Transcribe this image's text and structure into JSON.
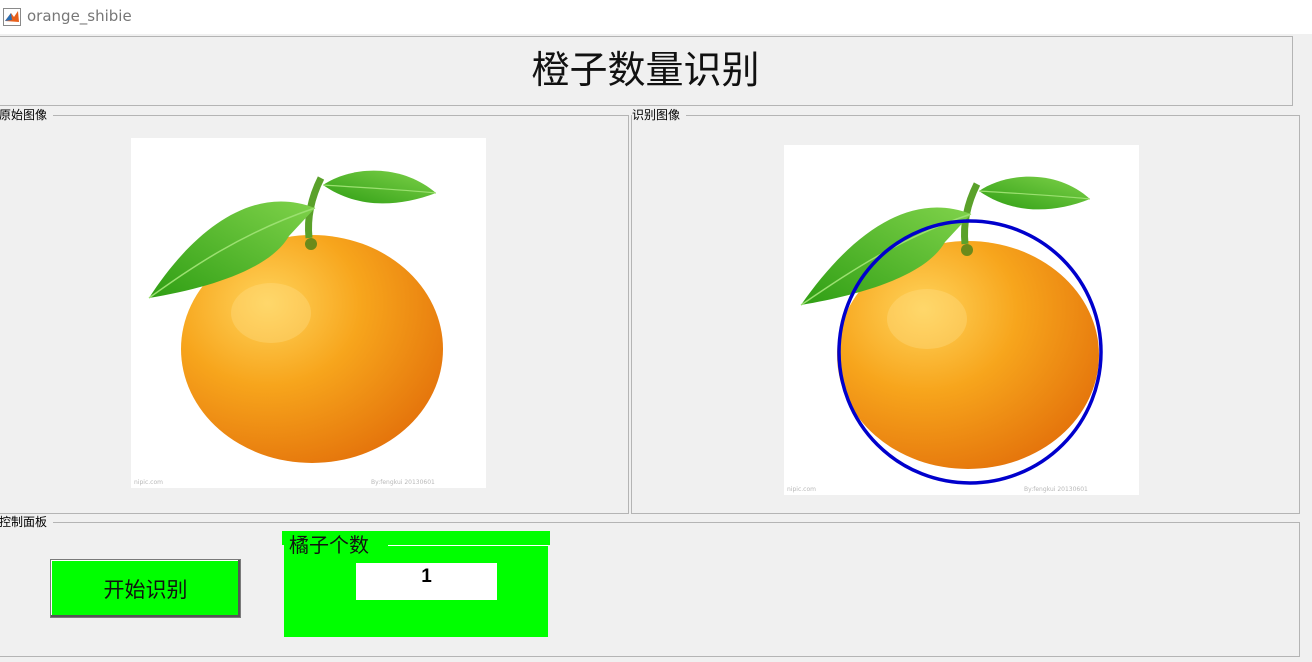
{
  "window": {
    "title": "orange_shibie",
    "icon": "matlab-icon"
  },
  "header": {
    "title": "橙子数量识别"
  },
  "panels": {
    "original": {
      "title": "原始图像"
    },
    "recognized": {
      "title": "识别图像"
    },
    "control": {
      "title": "控制面板"
    }
  },
  "controls": {
    "start_button": "开始识别",
    "count_group_title": "橘子个数",
    "count_value": "1"
  },
  "colors": {
    "button_bg": "#00ff00",
    "detection_circle": "#0000cc",
    "orange": "#f59a10",
    "leaf": "#3fae1f"
  }
}
